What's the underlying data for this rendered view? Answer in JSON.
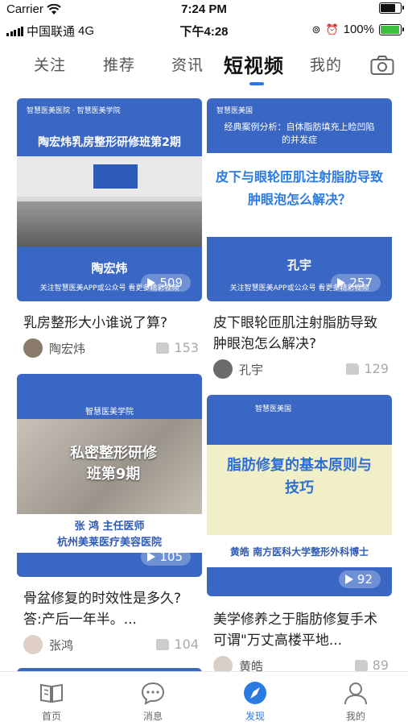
{
  "status": {
    "carrier": "Carrier",
    "time_top": "7:24 PM",
    "carrier2": "中国联通",
    "network": "4G",
    "time_2": "下午4:28",
    "battery_pct": "100%"
  },
  "tabs": [
    {
      "label": "关注"
    },
    {
      "label": "推荐"
    },
    {
      "label": "资讯"
    },
    {
      "label": "短视频"
    },
    {
      "label": "我的"
    }
  ],
  "cards": [
    {
      "thumb_brand": "智慧医美医院 · 智慧医美学院",
      "thumb_heading": "陶宏炜乳房整形研修班第2期",
      "thumb_name": "陶宏炜",
      "thumb_footer": "关注智慧医美APP或公众号 看更多精彩视频",
      "views": "509",
      "title": "乳房整形大小谁说了算?",
      "author": "陶宏炜",
      "likes": "153"
    },
    {
      "thumb_brand": "智慧医美国",
      "thumb_heading": "经典案例分析：自体脂肪填充上睑凹陷的并发症",
      "thumb_big": "皮下与眼轮匝肌注射脂肪导致肿眼泡怎么解决？",
      "thumb_name": "孔宇",
      "thumb_footer": "关注智慧医美APP或公众号 看更多精彩视频",
      "views": "257",
      "title": "皮下眼轮匝肌注射脂肪导致肿眼泡怎么解决?",
      "author": "孔宇",
      "likes": "129"
    },
    {
      "thumb_brand": "智慧医美学院",
      "thumb_heading": "私密整形研修班第9期",
      "thumb_sub1": "张 鸿 主任医师",
      "thumb_sub2": "杭州美莱医疗美容医院",
      "views": "105",
      "title": "骨盆修复的时效性是多久?答:产后一年半。...",
      "author": "张鸿",
      "likes": "104"
    },
    {
      "thumb_brand": "智慧医美国",
      "thumb_heading": "脂肪修复的基本原则与技巧",
      "thumb_sub1": "黄皓 南方医科大学整形外科博士",
      "views": "92",
      "title": "美学修养之于脂肪修复手术可谓\"万丈高楼平地...",
      "author": "黄皓",
      "likes": "89"
    }
  ],
  "tabbar": [
    {
      "label": "首页",
      "icon": "book-icon"
    },
    {
      "label": "消息",
      "icon": "chat-bubble-icon"
    },
    {
      "label": "发现",
      "icon": "compass-icon"
    },
    {
      "label": "我的",
      "icon": "person-icon"
    }
  ],
  "colors": {
    "accent": "#2a7ae2",
    "thumb_blue": "#3a66c4"
  }
}
